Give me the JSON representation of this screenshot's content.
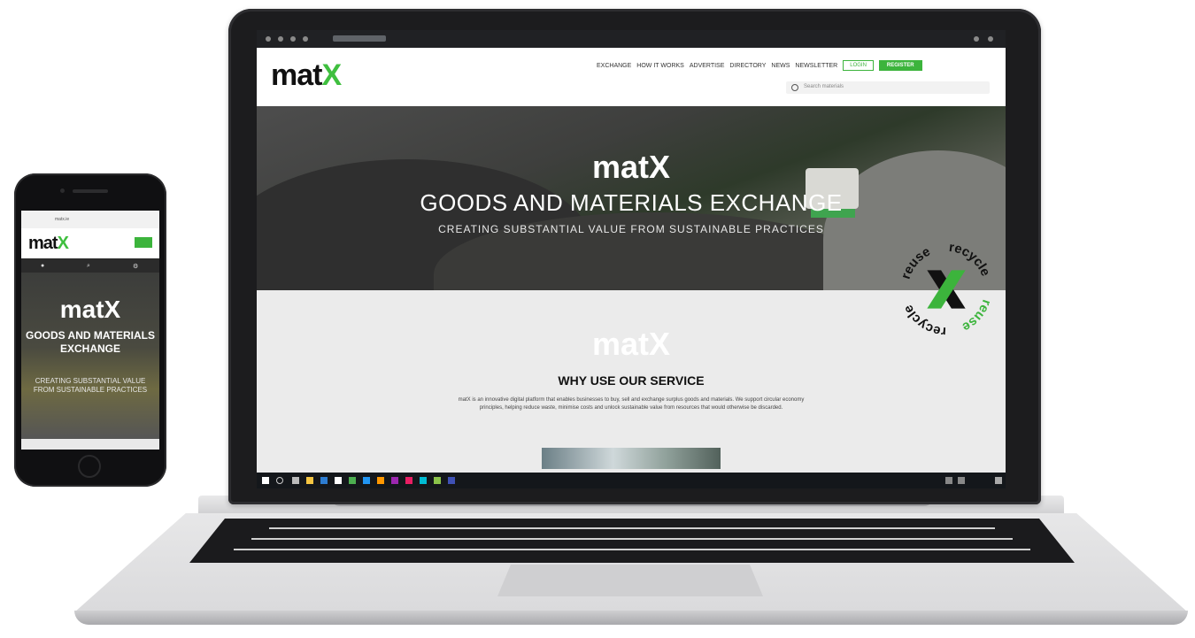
{
  "laptop": {
    "site": {
      "logo_main": "mat",
      "logo_x": "X",
      "nav": [
        "EXCHANGE",
        "HOW IT WORKS",
        "ADVERTISE",
        "DIRECTORY",
        "NEWS",
        "NEWSLETTER"
      ],
      "login_label": "LOGIN",
      "register_label": "REGISTER",
      "search_placeholder": "Search materials"
    },
    "hero": {
      "title": "GOODS AND MATERIALS EXCHANGE",
      "subtitle": "CREATING SUBSTANTIAL VALUE FROM SUSTAINABLE PRACTICES"
    },
    "section": {
      "title": "WHY USE OUR SERVICE",
      "body": "matX is an innovative digital platform that enables businesses to buy, sell and exchange surplus goods and materials. We support circular economy principles, helping reduce waste, minimise costs and unlock sustainable value from resources that would otherwise be discarded."
    },
    "badge": {
      "words": [
        "reuse",
        "recycle"
      ]
    }
  },
  "phone": {
    "url": "matx.ie",
    "hero": {
      "title": "GOODS AND MATERIALS EXCHANGE",
      "subtitle": "CREATING SUBSTANTIAL VALUE FROM SUSTAINABLE PRACTICES"
    }
  },
  "colors": {
    "brand_green": "#3cb43c",
    "dark": "#111111"
  }
}
